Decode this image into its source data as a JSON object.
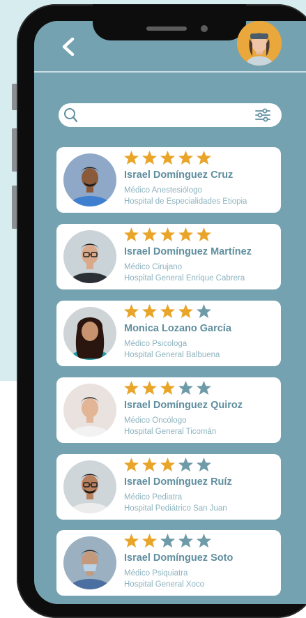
{
  "search": {
    "value": "",
    "placeholder": ""
  },
  "colors": {
    "star_filled": "#e8a52a",
    "star_empty": "#6f9aa8",
    "screen_bg": "#75a2b0",
    "name_text": "#5f8e9e"
  },
  "doctors": [
    {
      "name": "Israel Domínguez Cruz",
      "specialty": "Médico Anestesiólogo",
      "hospital": "Hospital de Especialidades Etiopia",
      "rating": 5
    },
    {
      "name": "Israel Domínguez Martínez",
      "specialty": "Médico Cirujano",
      "hospital": "Hospital General Enrique Cabrera",
      "rating": 5
    },
    {
      "name": "Monica Lozano García",
      "specialty": "Médico Psicologa",
      "hospital": "Hospital General Balbuena",
      "rating": 4
    },
    {
      "name": "Israel Domínguez Quiroz",
      "specialty": "Médico Oncólogo",
      "hospital": "Hospital General Ticomán",
      "rating": 3
    },
    {
      "name": "Israel Domínguez Ruíz",
      "specialty": "Médico Pediatra",
      "hospital": "Hospital Pediátrico San Juan",
      "rating": 3
    },
    {
      "name": "Israel Domínguez Soto",
      "specialty": "Médico Psiquiatra",
      "hospital": "Hospital General Xoco",
      "rating": 2
    }
  ]
}
